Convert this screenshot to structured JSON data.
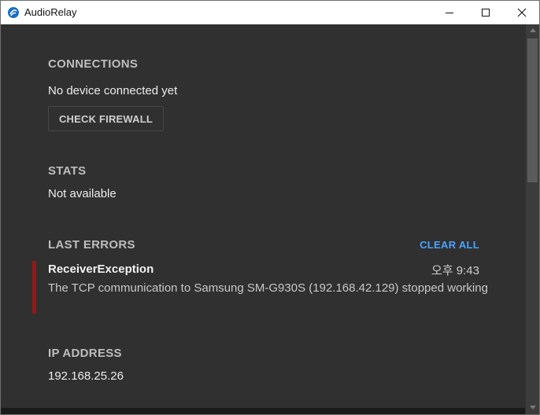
{
  "window": {
    "title": "AudioRelay",
    "app_icon": "audiorelay-logo-icon",
    "controls": [
      "minimize-icon",
      "maximize-icon",
      "close-icon"
    ]
  },
  "connections": {
    "heading": "CONNECTIONS",
    "status": "No device connected yet",
    "button_label": "CHECK FIREWALL"
  },
  "stats": {
    "heading": "STATS",
    "value": "Not available"
  },
  "last_errors": {
    "heading": "LAST ERRORS",
    "clear_label": "CLEAR ALL",
    "items": [
      {
        "name": "ReceiverException",
        "time": "오후 9:43",
        "message": "The TCP communication to Samsung SM-G930S (192.168.42.129) stopped working"
      }
    ]
  },
  "ip_address": {
    "heading": "IP ADDRESS",
    "value": "192.168.25.26"
  },
  "colors": {
    "background": "#303030",
    "accent": "#4aa3ff",
    "error": "#8c1c1c"
  }
}
